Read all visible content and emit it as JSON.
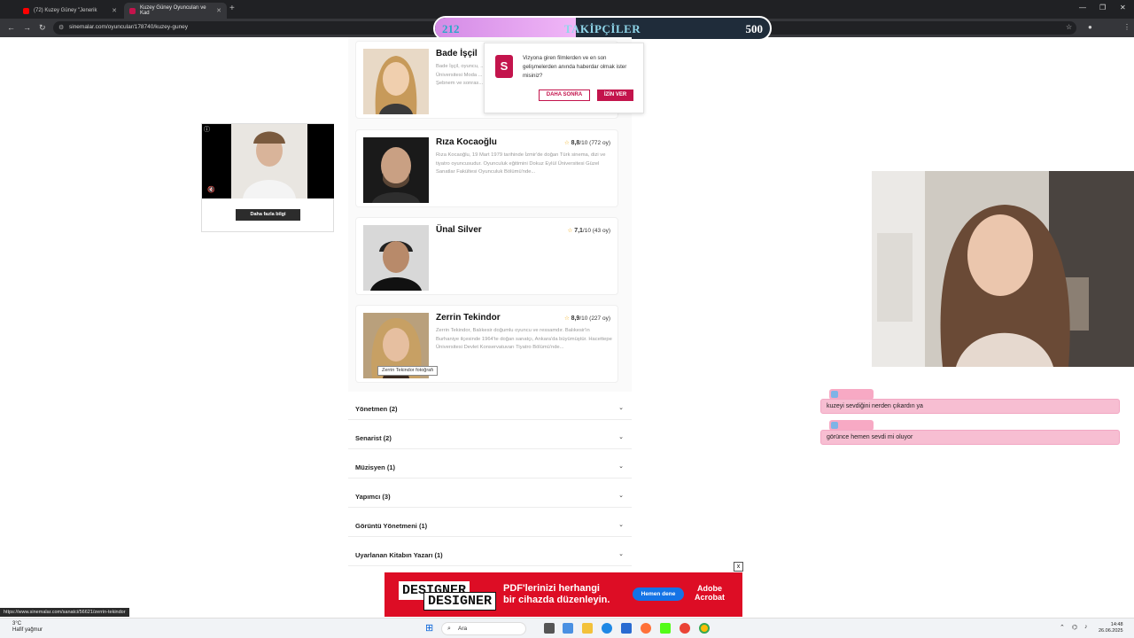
{
  "browser": {
    "tabs": [
      {
        "label": "(72) Kuzey Güney \"Jenerik",
        "active": false
      },
      {
        "label": "Kuzey Güney Oyuncuları ve Kad",
        "active": true
      }
    ],
    "url": "sinemalar.com/oyuncular/178740/kuzey-guney"
  },
  "followers": {
    "current": "212",
    "label": "TAKİPÇİLER",
    "goal": "500",
    "progress": 0.42
  },
  "popup": {
    "message": "Vizyona giren filmlerden ve en son gelişmelerden anında haberdar olmak ister misiniz?",
    "later_label": "DAHA SONRA",
    "allow_label": "İZİN VER",
    "logo": "S"
  },
  "actors": [
    {
      "name": "Bade İşçil",
      "rating": "",
      "votes": "",
      "desc": "Bade İşçil, oyuncu, ... Üniversitesi Moda ... Şebnem ve sonras..."
    },
    {
      "name": "Rıza Kocaoğlu",
      "rating": "8,8",
      "votes": "/10 (772 oy)",
      "desc": "Rıza Kocaoğlu, 19 Mart 1979 tarihinde İzmir'de doğan Türk sinema, dizi ve tiyatro oyuncusudur. Oyunculuk eğitimini Dokuz Eylül Üniversitesi Güzel Sanatlar Fakültesi Oyunculuk Bölümü'nde..."
    },
    {
      "name": "Ünal Silver",
      "rating": "7,1",
      "votes": "/10 (43 oy)",
      "desc": ""
    },
    {
      "name": "Zerrin Tekindor",
      "rating": "8,9",
      "votes": "/10 (227 oy)",
      "desc": "Zerrin Tekindor, Balıkesir doğumlu oyuncu ve ressamdır. Balıkesir'in Burhaniye ilçesinde 1964'te doğan sanatçı, Ankara'da büyümüştür. Hacettepe Üniversitesi Devlet Konservatuvarı Tiyatro Bölümü'nde..."
    }
  ],
  "tooltip": "Zerrin Tekindor fotoğrafı",
  "ad_left": {
    "info_label": "Daha fazla bilgi"
  },
  "accordions": [
    "Yönetmen (2)",
    "Senarist (2)",
    "Müzisyen (1)",
    "Yapımcı (3)",
    "Görüntü Yönetmeni (1)",
    "Uyarlanan Kitabın Yazarı (1)"
  ],
  "chat": [
    {
      "message": "kuzeyi sevdiğini nerden çıkardın ya"
    },
    {
      "message": "görünce hemen sevdi mi oluyor"
    }
  ],
  "banner": {
    "brand_top": "DESIGNER",
    "brand_bottom": "DESIGNER",
    "text_line1": "PDF'lerinizi herhangi",
    "text_line2": "bir cihazda düzenleyin.",
    "cta": "Hemen dene",
    "adobe_line1": "Adobe",
    "adobe_line2": "Acrobat",
    "close": "x"
  },
  "status_url": "https://www.sinemalar.com/sanatci/56621/zerrin-tekindor",
  "taskbar": {
    "weather_temp": "3°C",
    "weather_desc": "Hafif yağmur",
    "search": "Ara",
    "time": "14:48",
    "date": "26.06.2025"
  }
}
